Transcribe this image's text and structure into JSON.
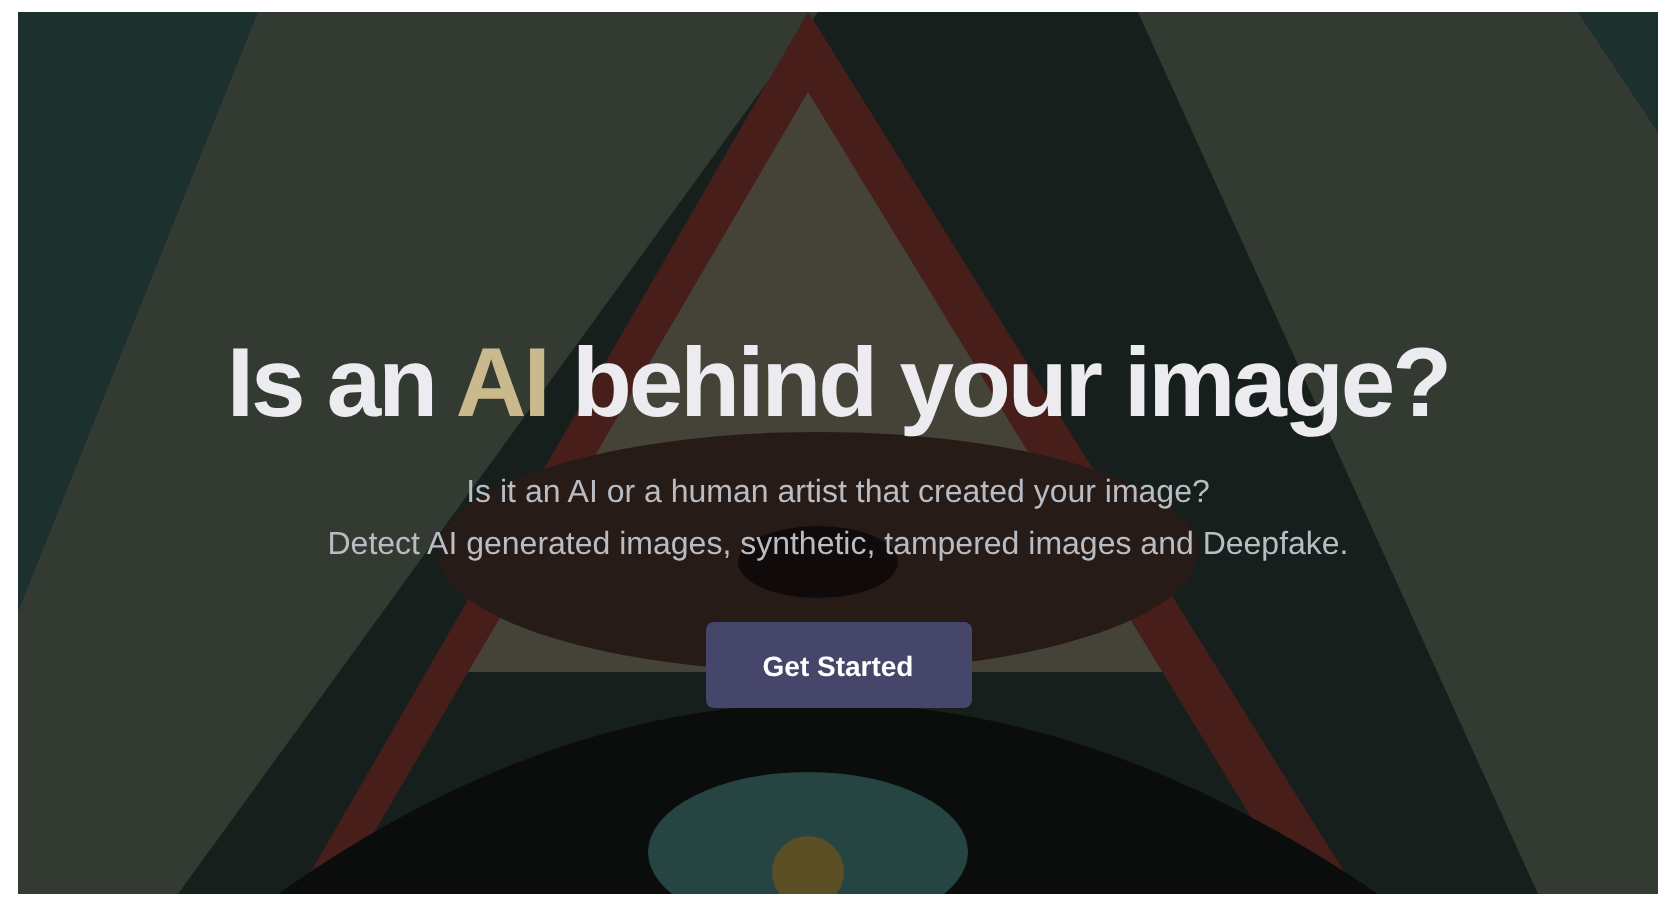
{
  "hero": {
    "background": {
      "kind": "picture"
    },
    "title": [
      {
        "text": "Is an ",
        "highlight": false
      },
      {
        "text": "AI",
        "highlight": true
      },
      {
        "text": " behind your image?",
        "highlight": false
      }
    ],
    "subtitle": [
      "Is it an AI or a human artist that created your image?",
      "Detect AI generated images, synthetic, tampered images and Deepfake."
    ],
    "button": {
      "label": "Get Started"
    }
  }
}
